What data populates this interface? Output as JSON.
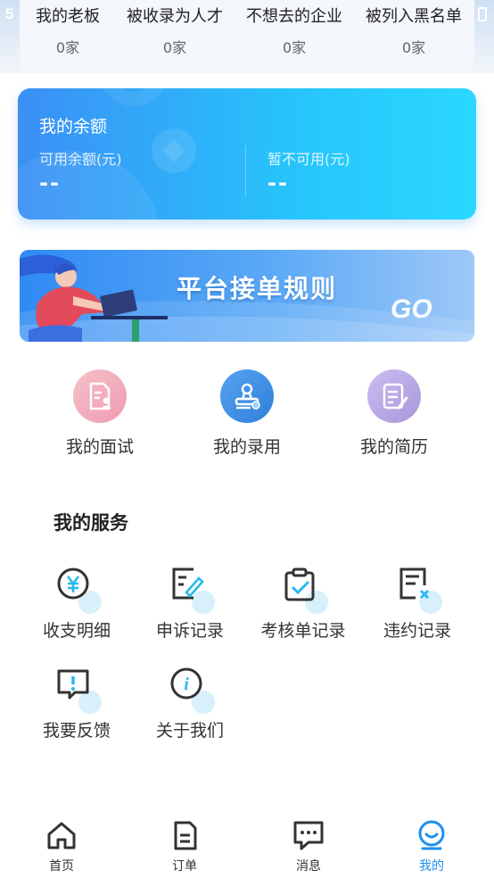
{
  "status_bar": {
    "time_partial": "5"
  },
  "stats": [
    {
      "label": "我的老板",
      "value": "0家"
    },
    {
      "label": "被收录为人才",
      "value": "0家"
    },
    {
      "label": "不想去的企业",
      "value": "0家"
    },
    {
      "label": "被列入黑名单",
      "value": "0家"
    }
  ],
  "balance": {
    "title": "我的余额",
    "available_label": "可用余额(元)",
    "available_value": "--",
    "unavailable_label": "暂不可用(元)",
    "unavailable_value": "--"
  },
  "banner": {
    "text": "平台接单规则",
    "go": "GO"
  },
  "quick_links": [
    {
      "label": "我的面试",
      "icon": "resume-person-icon",
      "color": "#f0a6b8"
    },
    {
      "label": "我的录用",
      "icon": "stamp-icon",
      "color": "#3d8fe8"
    },
    {
      "label": "我的简历",
      "icon": "document-edit-icon",
      "color": "#b8a8e0"
    }
  ],
  "services_title": "我的服务",
  "services": [
    {
      "label": "收支明细",
      "icon": "yuan-icon"
    },
    {
      "label": "申诉记录",
      "icon": "appeal-edit-icon"
    },
    {
      "label": "考核单记录",
      "icon": "clipboard-check-icon"
    },
    {
      "label": "违约记录",
      "icon": "document-x-icon"
    },
    {
      "label": "我要反馈",
      "icon": "feedback-icon"
    },
    {
      "label": "关于我们",
      "icon": "info-icon"
    }
  ],
  "tabs": [
    {
      "label": "首页",
      "icon": "home-icon",
      "active": false
    },
    {
      "label": "订单",
      "icon": "order-icon",
      "active": false
    },
    {
      "label": "消息",
      "icon": "message-icon",
      "active": false
    },
    {
      "label": "我的",
      "icon": "profile-icon",
      "active": true
    }
  ],
  "colors": {
    "accent": "#1f8ff0",
    "card_start": "#3b8ff5",
    "card_end": "#2ad8fe"
  }
}
